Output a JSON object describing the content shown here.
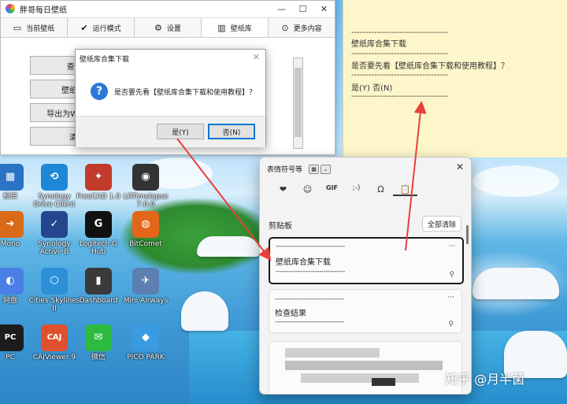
{
  "app": {
    "title": "胖哥每日壁纸",
    "tabs": [
      {
        "label": "当前壁纸",
        "icon": "monitor-icon"
      },
      {
        "label": "运行模式",
        "icon": "checkmark-icon"
      },
      {
        "label": "设置",
        "icon": "gear-icon"
      },
      {
        "label": "壁纸库",
        "icon": "library-icon"
      },
      {
        "label": "更多内容",
        "icon": "more-circle-icon"
      }
    ],
    "buttons": [
      "查看/",
      "壁纸库",
      "导出为Win",
      "清除"
    ]
  },
  "dialog": {
    "title": "壁纸库合集下载",
    "message": "是否要先看【壁纸库合集下载和使用教程】？",
    "yes_label": "是(Y)",
    "no_label": "否(N)"
  },
  "note": {
    "lines": [
      "----------------------------------",
      "壁纸库合集下载",
      "----------------------------------",
      "是否要先看【壁纸库合集下载和使用教程】？",
      "----------------------------------",
      "是(Y)   否(N)",
      "----------------------------------"
    ]
  },
  "panel": {
    "title": "表情符号等",
    "categories": [
      "heart-sticker-icon",
      "emoji-icon",
      "gif-icon",
      "kaomoji-icon",
      "symbols-icon",
      "clipboard-icon"
    ],
    "category_glyphs": [
      "❤",
      "☺",
      "GIF",
      ";-)",
      "Ω",
      "📋"
    ],
    "section_title": "剪贴板",
    "clear_all_label": "全部清除",
    "items": [
      {
        "text": "壁纸库合集下载",
        "dash": "--------------------------------"
      },
      {
        "text": "检查结果",
        "dash": "--------------------------------"
      }
    ],
    "more": "···",
    "pin": "⚲"
  },
  "desktop": {
    "icons": [
      {
        "label": "标识",
        "color": "#2a73c5",
        "glyph": "▦"
      },
      {
        "label": "Synology Drive Client",
        "color": "#1f88d6",
        "glyph": "⟲"
      },
      {
        "label": "FreeCAD 1.0",
        "color": "#c23a2b",
        "glyph": "✦"
      },
      {
        "label": "LRTimelapse 7.0.0",
        "color": "#333333",
        "glyph": "◉"
      },
      {
        "label": "Mono",
        "color": "#d86a18",
        "glyph": "➜"
      },
      {
        "label": "Synology Active B",
        "color": "#25468e",
        "glyph": "✓"
      },
      {
        "label": "Logitech G Hub",
        "color": "#111111",
        "glyph": "G"
      },
      {
        "label": "BitComet",
        "color": "#e2651a",
        "glyph": "◍"
      },
      {
        "label": "网盘",
        "color": "#4b7ee6",
        "glyph": "◐"
      },
      {
        "label": "Cities Skylines II",
        "color": "#2c8fd8",
        "glyph": "⬡"
      },
      {
        "label": "Dashboard",
        "color": "#3a3a3a",
        "glyph": "▮"
      },
      {
        "label": "Mini Airways",
        "color": "#5a7fb0",
        "glyph": "✈"
      },
      {
        "label": "PC",
        "color": "#1c1c1c",
        "glyph": "PC"
      },
      {
        "label": "CAJViewer 9",
        "color": "#e0502e",
        "glyph": "CAJ"
      },
      {
        "label": "微信",
        "color": "#2dbb3f",
        "glyph": "✉"
      },
      {
        "label": "PICO PARK",
        "color": "#3a9be0",
        "glyph": "◆"
      }
    ]
  },
  "watermark": "知乎 @月半菌"
}
